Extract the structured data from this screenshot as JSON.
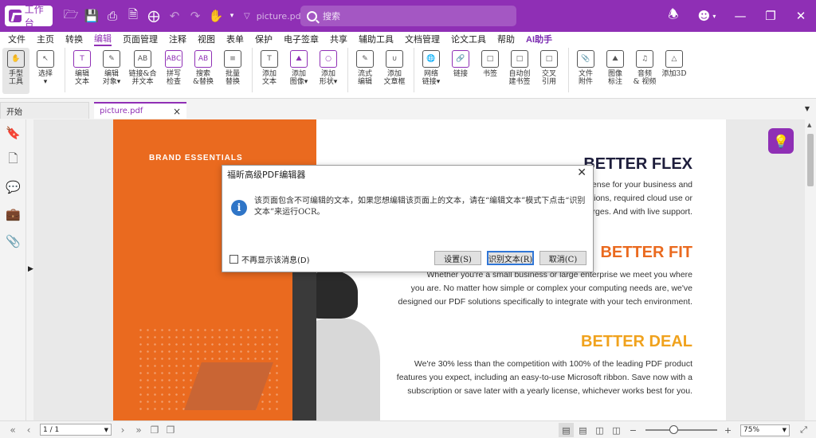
{
  "app": {
    "home_label": "工作台",
    "filename_title": "picture.pdf",
    "search_placeholder": "搜索",
    "accent": "#8f2fb5"
  },
  "quick_access": [
    "open-folder-icon",
    "save-icon",
    "print-icon",
    "new-doc-icon",
    "add-doc-icon",
    "undo-icon",
    "redo-icon",
    "hand-tool-icon",
    "customize-icon"
  ],
  "window_controls": [
    "notification-icon",
    "account-icon",
    "minimize-icon",
    "restore-icon",
    "close-icon"
  ],
  "menu": {
    "items": [
      "文件",
      "主页",
      "转换",
      "编辑",
      "页面管理",
      "注释",
      "视图",
      "表单",
      "保护",
      "电子签章",
      "共享",
      "辅助工具",
      "文档管理",
      "论文工具",
      "帮助",
      "AI助手"
    ],
    "active_index": 3
  },
  "ribbon": {
    "buttons": [
      {
        "label": "手型\n工具",
        "icon": "hand-icon"
      },
      {
        "label": "选择\n▾",
        "icon": "select-cursor-icon"
      },
      {
        "label": "编辑\n文本",
        "icon": "edit-text-icon"
      },
      {
        "label": "编辑\n对象▾",
        "icon": "edit-object-icon"
      },
      {
        "label": "链接&合\n并文本",
        "icon": "link-merge-text-icon"
      },
      {
        "label": "拼写\n检查",
        "icon": "spell-check-icon"
      },
      {
        "label": "搜索\n&替换",
        "icon": "search-replace-icon"
      },
      {
        "label": "批量\n替换",
        "icon": "batch-replace-icon"
      },
      {
        "label": "添加\n文本",
        "icon": "add-text-icon"
      },
      {
        "label": "添加\n图像▾",
        "icon": "add-image-icon"
      },
      {
        "label": "添加\n形状▾",
        "icon": "add-shape-icon"
      },
      {
        "label": "流式\n编辑",
        "icon": "flow-edit-icon"
      },
      {
        "label": "添加\n文章框",
        "icon": "article-box-icon"
      },
      {
        "label": "网络\n链接▾",
        "icon": "web-link-icon"
      },
      {
        "label": "链接",
        "icon": "link-icon"
      },
      {
        "label": "书签",
        "icon": "bookmark-icon"
      },
      {
        "label": "自动创\n建书签",
        "icon": "auto-bookmark-icon"
      },
      {
        "label": "交叉\n引用",
        "icon": "cross-reference-icon"
      },
      {
        "label": "文件\n附件",
        "icon": "file-attachment-icon"
      },
      {
        "label": "图像\n标注",
        "icon": "image-annotation-icon"
      },
      {
        "label": "音频\n& 视频",
        "icon": "audio-video-icon"
      },
      {
        "label": "添加3D",
        "icon": "add-3d-icon"
      }
    ]
  },
  "tabs": {
    "start": "开始",
    "file": "picture.pdf"
  },
  "sidebar": [
    "bookmark-icon",
    "pages-icon",
    "comments-icon",
    "toolbox-icon",
    "attachment-icon"
  ],
  "document": {
    "brand_label": "BRAND ESSENTIALS",
    "heading_flex": "BETTER FLEX",
    "heading_fit": "BETTER FIT",
    "heading_deal": "BETTER DEAL",
    "flex_lines": [
      "ense for your business and",
      "tions, required cloud use or",
      "rges. And with live support."
    ],
    "fit_lines": [
      "Whether you're a small business or large enterprise we meet you where",
      "you are. No matter how simple or complex your computing needs are, we've",
      "designed our PDF solutions specifically to integrate with your tech environment."
    ],
    "deal_lines": [
      "We're 30% less than the competition with 100% of the leading PDF product",
      "features you expect, including an easy-to-use Microsoft ribbon. Save now with a",
      "subscription or save later with a yearly license, whichever works best for you."
    ],
    "colors": {
      "orange": "#ea6a1f",
      "navy": "#1e1e3c",
      "amber": "#f0a21d"
    }
  },
  "dialog": {
    "title": "福昕高级PDF编辑器",
    "message": "该页面包含不可编辑的文本，如果您想编辑该页面上的文本，请在“编辑文本”模式下点击“识别文本”来运行OCR。",
    "checkbox_label": "不再显示该消息(D)",
    "buttons": [
      "设置(S)",
      "识别文本(R)",
      "取消(C)"
    ]
  },
  "status": {
    "page_indicator": "1 / 1",
    "zoom": "75%"
  }
}
